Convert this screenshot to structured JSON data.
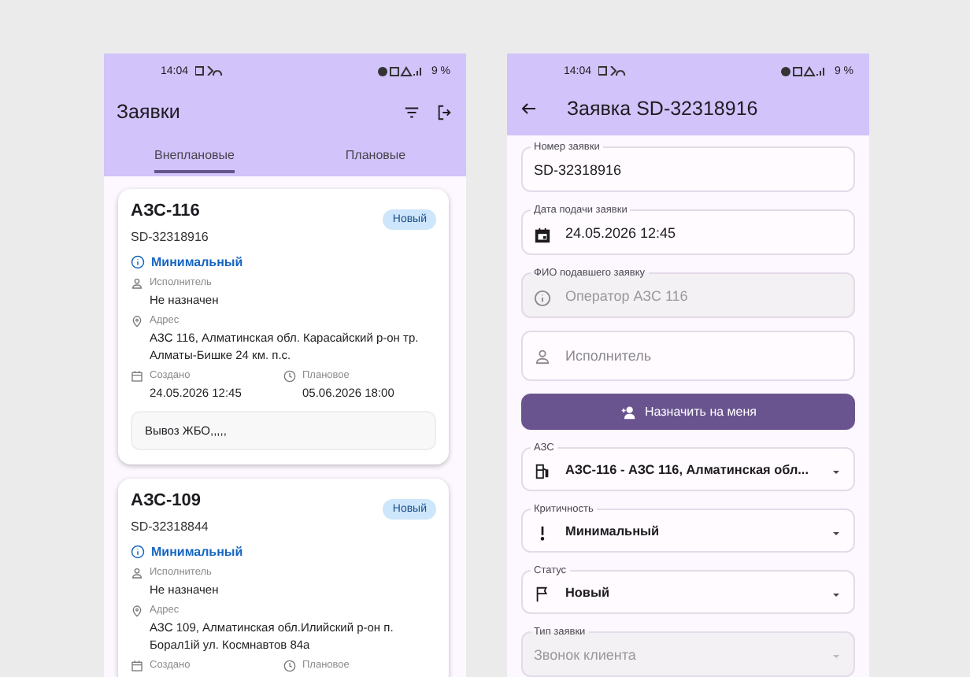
{
  "list_screen": {
    "status_bar": {
      "time": "14:04",
      "battery": "9 %"
    },
    "title": "Заявки",
    "tabs": [
      {
        "label": "Внеплановые",
        "selected": true
      },
      {
        "label": "Плановые",
        "selected": false
      }
    ],
    "cards": [
      {
        "title": "АЗС-116",
        "number": "SD-32318916",
        "status": "Новый",
        "priority": "Минимальный",
        "executor_label": "Исполнитель",
        "executor": "Не назначен",
        "address_label": "Адрес",
        "address": "АЗС 116, Алматинская обл. Карасайский р-он тр. Алматы-Бишке 24 км. п.с.",
        "created_label": "Создано",
        "created": "24.05.2026 12:45",
        "planned_label": "Плановое",
        "planned": "05.06.2026 18:00",
        "note": "Вывоз ЖБО,,,,,"
      },
      {
        "title": "АЗС-109",
        "number": "SD-32318844",
        "status": "Новый",
        "priority": "Минимальный",
        "executor_label": "Исполнитель",
        "executor": "Не назначен",
        "address_label": "Адрес",
        "address": "АЗС 109, Алматинская обл.Илийский р-он п. Борал1ій  ул. Космнавтов 84а",
        "created_label": "Создано",
        "planned_label": "Плановое"
      }
    ]
  },
  "detail_screen": {
    "status_bar": {
      "time": "14:04",
      "battery": "9 %"
    },
    "title": "Заявка SD-32318916",
    "fields": [
      {
        "kind": "text",
        "label": "Номер заявки",
        "value": "SD-32318916",
        "disabled": false
      },
      {
        "kind": "date",
        "label": "Дата подачи заявки",
        "value": "24.05.2026 12:45",
        "disabled": false
      },
      {
        "kind": "info",
        "label": "ФИО подавшего заявку",
        "value": "Оператор АЗС 116",
        "disabled": true
      },
      {
        "kind": "person",
        "placeholder": "Исполнитель",
        "disabled": false
      },
      {
        "kind": "button",
        "label": "Назначить на меня"
      },
      {
        "kind": "station_select",
        "label": "АЗС",
        "value": "АЗС-116 - АЗС 116, Алматинская обл...",
        "disabled": false
      },
      {
        "kind": "priority_select",
        "label": "Критичность",
        "value": "Минимальный",
        "disabled": false
      },
      {
        "kind": "status_select",
        "label": "Статус",
        "value": "Новый",
        "disabled": false
      },
      {
        "kind": "type_select",
        "label": "Тип заявки",
        "value": "Звонок клиента",
        "disabled": true
      }
    ]
  }
}
